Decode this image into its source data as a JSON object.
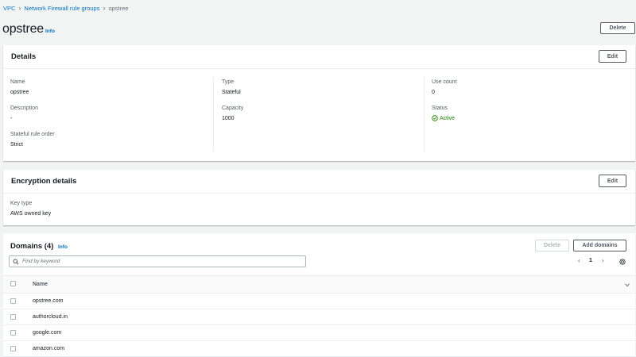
{
  "breadcrumb": {
    "item1": "VPC",
    "item2": "Network Firewall rule groups",
    "current": "opstree"
  },
  "page": {
    "title": "opstree",
    "info": "Info",
    "delete_label": "Delete"
  },
  "details": {
    "title": "Details",
    "edit_label": "Edit",
    "name_label": "Name",
    "name_value": "opstree",
    "description_label": "Description",
    "description_value": "-",
    "rule_order_label": "Stateful rule order",
    "rule_order_value": "Strict",
    "type_label": "Type",
    "type_value": "Stateful",
    "capacity_label": "Capacity",
    "capacity_value": "1000",
    "use_count_label": "Use count",
    "use_count_value": "0",
    "status_label": "Status",
    "status_value": "Active"
  },
  "encryption": {
    "title": "Encryption details",
    "edit_label": "Edit",
    "key_type_label": "Key type",
    "key_type_value": "AWS owned key"
  },
  "domains": {
    "title": "Domains (4)",
    "info": "Info",
    "delete_label": "Delete",
    "add_label": "Add domains",
    "search_placeholder": "Find by keyword",
    "page_number": "1",
    "column_name": "Name",
    "rows": [
      "opstree.com",
      "authorcloud.in",
      "google.com",
      "amazon.com"
    ]
  },
  "colors": {
    "link": "#0073bb",
    "success": "#1d8102",
    "border": "#eaeded"
  }
}
